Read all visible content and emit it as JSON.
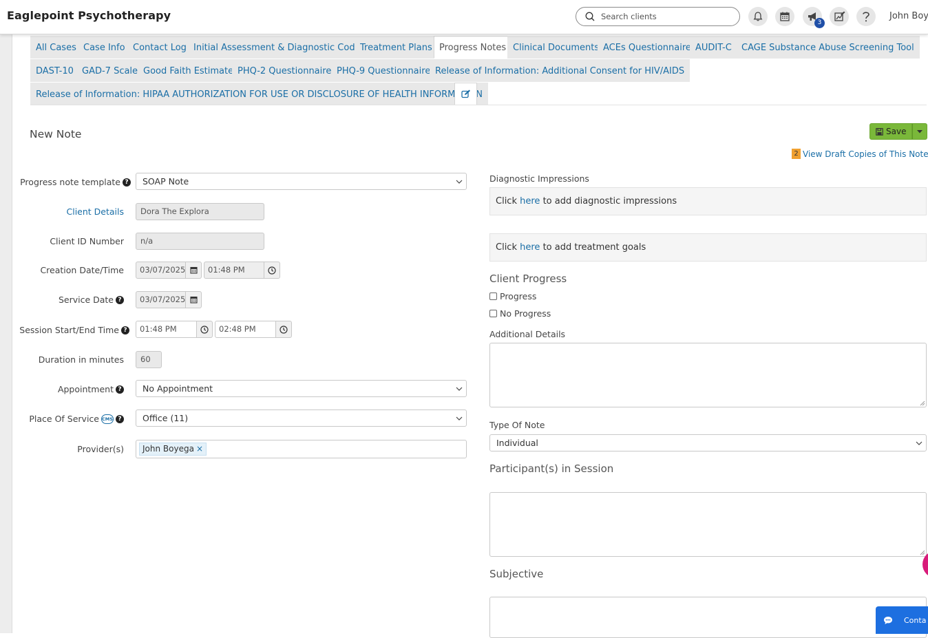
{
  "header": {
    "brand": "Eaglepoint Psychotherapy",
    "search_placeholder": "Search clients",
    "notification_count": "3",
    "user_name": "John Boy"
  },
  "tabs": [
    {
      "label": "All Cases"
    },
    {
      "label": "Case Info"
    },
    {
      "label": "Contact Log"
    },
    {
      "label": "Initial Assessment & Diagnostic Codes"
    },
    {
      "label": "Treatment Plans"
    },
    {
      "label": "Progress Notes"
    },
    {
      "label": "Clinical Documents"
    },
    {
      "label": "ACEs Questionnaire"
    },
    {
      "label": "AUDIT-C"
    },
    {
      "label": "CAGE Substance Abuse Screening Tool"
    },
    {
      "label": "DAST-10"
    },
    {
      "label": "GAD-7 Scale"
    },
    {
      "label": "Good Faith Estimate"
    },
    {
      "label": "PHQ-2 Questionnaire"
    },
    {
      "label": "PHQ-9 Questionnaire"
    },
    {
      "label": "Release of Information: Additional Consent for HIV/AIDS"
    },
    {
      "label": "Release of Information: HIPAA AUTHORIZATION FOR USE OR DISCLOSURE OF HEALTH INFORMATION"
    }
  ],
  "active_tab": "Progress Notes",
  "page": {
    "title": "New Note",
    "save_label": "Save",
    "draft_count": "2",
    "draft_label": "View Draft Copies of This Note"
  },
  "form": {
    "template_label": "Progress note template",
    "template_value": "SOAP Note",
    "client_details_label": "Client Details",
    "client_name": "Dora The Explora",
    "client_id_label": "Client ID Number",
    "client_id_value": "n/a",
    "creation_label": "Creation Date/Time",
    "creation_date": "03/07/2025",
    "creation_time": "01:48 PM",
    "service_date_label": "Service Date",
    "service_date": "03/07/2025",
    "session_label": "Session Start/End Time",
    "session_start": "01:48 PM",
    "session_end": "02:48 PM",
    "duration_label": "Duration in minutes",
    "duration_value": "60",
    "appointment_label": "Appointment",
    "appointment_value": "No Appointment",
    "place_label": "Place Of Service",
    "cms_badge": "CMS",
    "place_value": "Office (11)",
    "providers_label": "Provider(s)",
    "provider_chip": "John Boyega",
    "chip_remove": "×"
  },
  "right": {
    "diag_label": "Diagnostic Impressions",
    "click_text": "Click",
    "here_text": "here",
    "diag_suffix": "to add diagnostic impressions",
    "goals_suffix": "to add treatment goals",
    "client_progress_heading": "Client Progress",
    "progress_option": "Progress",
    "no_progress_option": "No Progress",
    "additional_details_label": "Additional Details",
    "type_of_note_label": "Type Of Note",
    "type_of_note_value": "Individual",
    "participants_heading": "Participant(s) in Session",
    "subjective_heading": "Subjective"
  },
  "chat": {
    "label": "Conta"
  },
  "colors": {
    "link": "#1a6ea6",
    "save_green": "#7ab83a",
    "badge_orange": "#f0a030",
    "badge_blue": "#1f4fa8",
    "chat_blue": "#1d6fe0",
    "fab_pink": "#d81b7a"
  }
}
